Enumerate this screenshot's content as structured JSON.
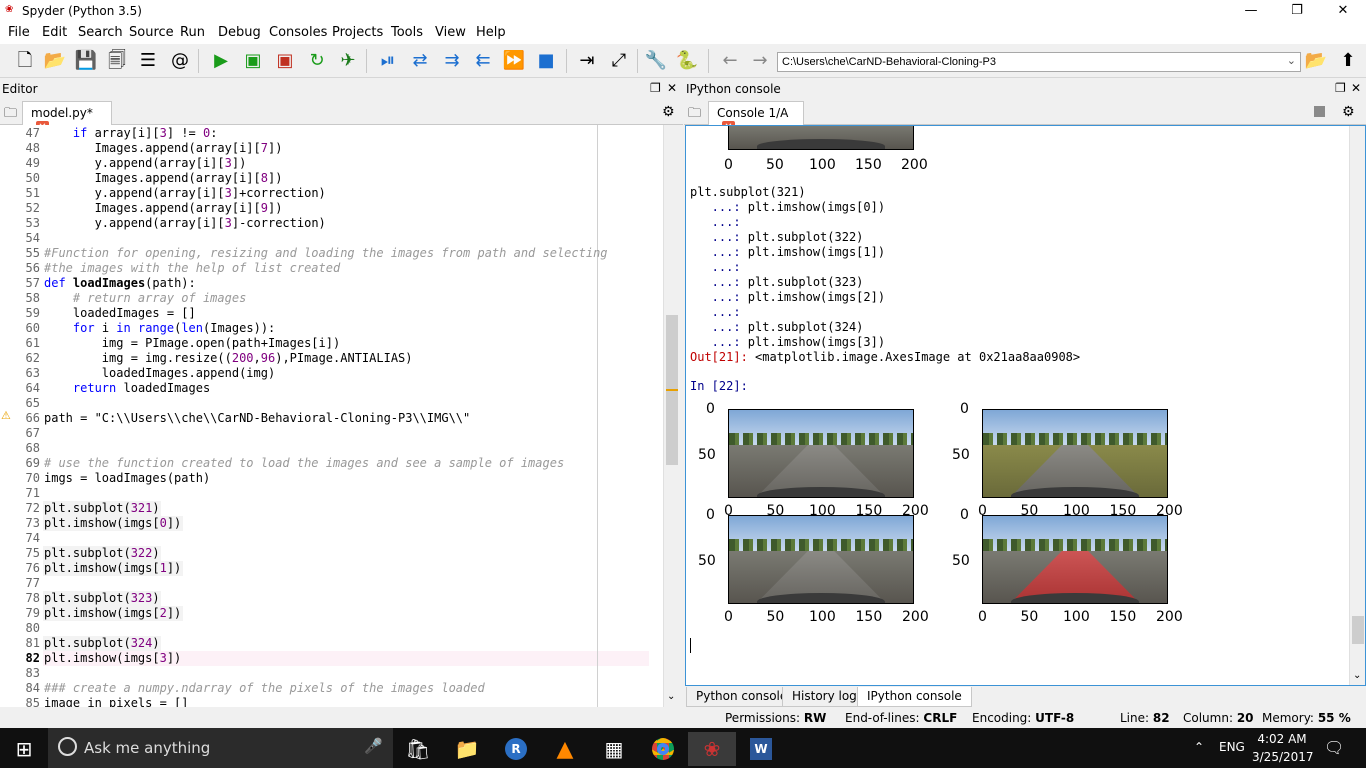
{
  "window": {
    "title": "Spyder (Python 3.5)"
  },
  "menu": [
    "File",
    "Edit",
    "Search",
    "Source",
    "Run",
    "Debug",
    "Consoles",
    "Projects",
    "Tools",
    "View",
    "Help"
  ],
  "toolbar": {
    "path": "C:\\Users\\che\\CarND-Behavioral-Cloning-P3"
  },
  "editor": {
    "pane_title": "Editor",
    "tab_label": "model.py*",
    "lines": [
      {
        "n": "47",
        "t": "    if array[i][3] != 0:"
      },
      {
        "n": "48",
        "t": "       Images.append(array[i][7])"
      },
      {
        "n": "49",
        "t": "       y.append(array[i][3])"
      },
      {
        "n": "50",
        "t": "       Images.append(array[i][8])"
      },
      {
        "n": "51",
        "t": "       y.append(array[i][3]+correction)"
      },
      {
        "n": "52",
        "t": "       Images.append(array[i][9])"
      },
      {
        "n": "53",
        "t": "       y.append(array[i][3]-correction)"
      },
      {
        "n": "54",
        "t": ""
      },
      {
        "n": "55",
        "t": "#Function for opening, resizing and loading the images from path and selecting"
      },
      {
        "n": "56",
        "t": "#the images with the help of list created"
      },
      {
        "n": "57",
        "t": "def loadImages(path):"
      },
      {
        "n": "58",
        "t": "    # return array of images"
      },
      {
        "n": "59",
        "t": "    loadedImages = []"
      },
      {
        "n": "60",
        "t": "    for i in range(len(Images)):"
      },
      {
        "n": "61",
        "t": "        img = PImage.open(path+Images[i])"
      },
      {
        "n": "62",
        "t": "        img = img.resize((200,96),PImage.ANTIALIAS)"
      },
      {
        "n": "63",
        "t": "        loadedImages.append(img)"
      },
      {
        "n": "64",
        "t": "    return loadedImages"
      },
      {
        "n": "65",
        "t": ""
      },
      {
        "n": "66",
        "t": "path = \"C:\\\\Users\\\\che\\\\CarND-Behavioral-Cloning-P3\\\\IMG\\\\\""
      },
      {
        "n": "67",
        "t": ""
      },
      {
        "n": "68",
        "t": ""
      },
      {
        "n": "69",
        "t": "# use the function created to load the images and see a sample of images"
      },
      {
        "n": "70",
        "t": "imgs = loadImages(path)"
      },
      {
        "n": "71",
        "t": ""
      },
      {
        "n": "72",
        "t": "plt.subplot(321)"
      },
      {
        "n": "73",
        "t": "plt.imshow(imgs[0])"
      },
      {
        "n": "74",
        "t": ""
      },
      {
        "n": "75",
        "t": "plt.subplot(322)"
      },
      {
        "n": "76",
        "t": "plt.imshow(imgs[1])"
      },
      {
        "n": "77",
        "t": ""
      },
      {
        "n": "78",
        "t": "plt.subplot(323)"
      },
      {
        "n": "79",
        "t": "plt.imshow(imgs[2])"
      },
      {
        "n": "80",
        "t": ""
      },
      {
        "n": "81",
        "t": "plt.subplot(324)"
      },
      {
        "n": "82",
        "t": "plt.imshow(imgs[3])"
      },
      {
        "n": "83",
        "t": ""
      },
      {
        "n": "84",
        "t": "### create a numpy.ndarray of the pixels of the images loaded"
      },
      {
        "n": "85",
        "t": "image_in_pixels = []"
      }
    ]
  },
  "console": {
    "pane_title": "IPython console",
    "tab_label": "Console 1/A",
    "prev_axis_ticks": [
      "0",
      "50",
      "100",
      "150",
      "200"
    ],
    "history": [
      "plt.subplot(321)",
      "   ...: plt.imshow(imgs[0])",
      "   ...: ",
      "   ...: plt.subplot(322)",
      "   ...: plt.imshow(imgs[1])",
      "   ...: ",
      "   ...: plt.subplot(323)",
      "   ...: plt.imshow(imgs[2])",
      "   ...: ",
      "   ...: plt.subplot(324)",
      "   ...: plt.imshow(imgs[3])"
    ],
    "out_prompt": "Out[21]:",
    "out_text": " <matplotlib.image.AxesImage at 0x21aa8aa0908>",
    "in_prompt": "In [22]:",
    "y_ticks": [
      "0",
      "50"
    ],
    "x_ticks": [
      "0",
      "50",
      "100",
      "150",
      "200"
    ]
  },
  "bottom_tabs": [
    "Python console",
    "History log",
    "IPython console"
  ],
  "status": {
    "permissions_label": "Permissions:",
    "permissions": "RW",
    "eol_label": "End-of-lines:",
    "eol": "CRLF",
    "encoding_label": "Encoding:",
    "encoding": "UTF-8",
    "line_label": "Line:",
    "line": "82",
    "column_label": "Column:",
    "column": "20",
    "memory_label": "Memory:",
    "memory": "55 %"
  },
  "taskbar": {
    "search_placeholder": "Ask me anything",
    "lang": "ENG",
    "time": "4:02 AM",
    "date": "3/25/2017"
  }
}
